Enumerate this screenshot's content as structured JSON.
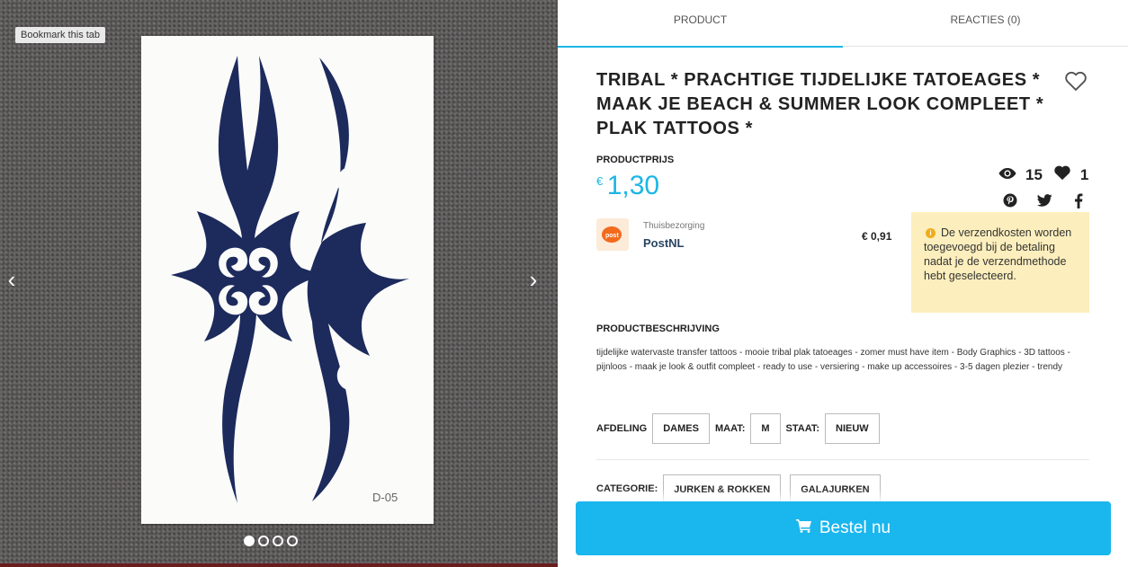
{
  "gallery": {
    "bookmark_label": "Bookmark this tab",
    "card_code": "D-05",
    "prev_icon": "‹",
    "next_icon": "›",
    "slide_count": 4,
    "active_slide": 1,
    "tattoo_color": "#1c2a5c"
  },
  "tabs": [
    {
      "label": "PRODUCT",
      "active": true
    },
    {
      "label": "REACTIES (0)",
      "active": false
    }
  ],
  "product": {
    "title": "TRIBAL * PRACHTIGE TIJDELIJKE TATOEAGES * MAAK JE BEACH & SUMMER LOOK COMPLEET * PLAK TATTOOS *",
    "price_label": "PRODUCTPRIJS",
    "currency": "€",
    "price": "1,30",
    "accent_color": "#1cb6e6"
  },
  "stats": {
    "views": "15",
    "likes": "1",
    "view_icon": "eye-icon",
    "like_icon": "heart-icon"
  },
  "shipping": {
    "type": "Thuisbezorging",
    "carrier": "PostNL",
    "price": "€ 0,91",
    "notice": "De verzendkosten worden toegevoegd bij de betaling nadat je de verzendmethode hebt geselecteerd."
  },
  "description": {
    "label": "PRODUCTBESCHRIJVING",
    "text": "tijdelijke watervaste transfer tattoos - mooie tribal plak tatoeages - zomer must have item - Body Graphics - 3D tattoos - pijnloos - maak je look & outfit compleet - ready to use - versiering - make up accessoires - 3-5 dagen plezier - trendy"
  },
  "attributes": {
    "afdeling_label": "AFDELING",
    "afdeling_value": "DAMES",
    "maat_label": "MAAT:",
    "maat_value": "M",
    "staat_label": "STAAT:",
    "staat_value": "NIEUW"
  },
  "categories": {
    "label": "CATEGORIE:",
    "items": [
      "JURKEN & ROKKEN",
      "GALAJURKEN"
    ]
  },
  "order_button": {
    "label": "Bestel nu",
    "icon": "cart-icon"
  }
}
